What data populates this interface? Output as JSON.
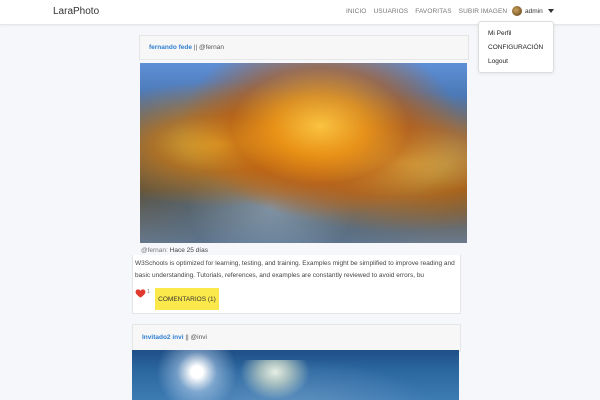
{
  "navbar": {
    "brand": "LaraPhoto",
    "links": [
      "INICIO",
      "USUARIOS",
      "FAVORITAS",
      "SUBIR IMAGEN"
    ],
    "user": "admin"
  },
  "dropdown": {
    "items": [
      "Mi Perfil",
      "CONFIGURACIÓN",
      "Logout"
    ]
  },
  "post1": {
    "name": "fernando fede",
    "separator": " || ",
    "handle": "@fernan",
    "meta_handle": "@fernan:",
    "meta_time": "Hace 25 días",
    "description": "W3Schools is optimized for learning, testing, and training. Examples might be simplified to improve reading and basic understanding. Tutorials, references, and examples are constantly reviewed to avoid errors, bu",
    "likes": "1",
    "comments_button": "COMENTARIOS (1)"
  },
  "post2": {
    "name": "Invitado2 invi",
    "separator": " || ",
    "handle": "@invi"
  },
  "colors": {
    "accent_link": "#2f7fd0",
    "comments_button": "#fbe84b",
    "heart": "#e03a2f"
  }
}
